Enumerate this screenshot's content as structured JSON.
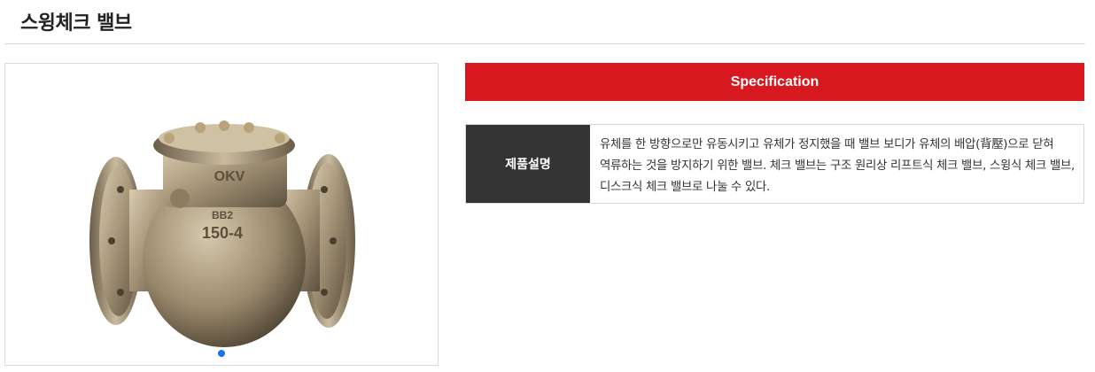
{
  "page": {
    "title": "스윙체크 밸브"
  },
  "gallery": {
    "image_icon": "swing-check-valve-photo",
    "image_markings": {
      "brand": "OKV",
      "model": "BB2",
      "rating": "150-4"
    },
    "dots_count": 1,
    "active_dot": 1
  },
  "spec": {
    "header": "Specification",
    "header_color": "#d7191f",
    "rows": [
      {
        "label": "제품설명",
        "value": "유체를 한 방향으로만 유동시키고 유체가 정지했을 때 밸브 보디가 유체의 배압(背壓)으로 닫혀 역류하는 것을 방지하기 위한 밸브. 체크 밸브는 구조 원리상 리프트식 체크 밸브, 스윙식 체크 밸브, 디스크식 체크 밸브로 나눌 수 있다."
      }
    ]
  },
  "colors": {
    "label_bg": "#333333",
    "dot_active": "#1a73e8",
    "border": "#d8d8d8"
  }
}
